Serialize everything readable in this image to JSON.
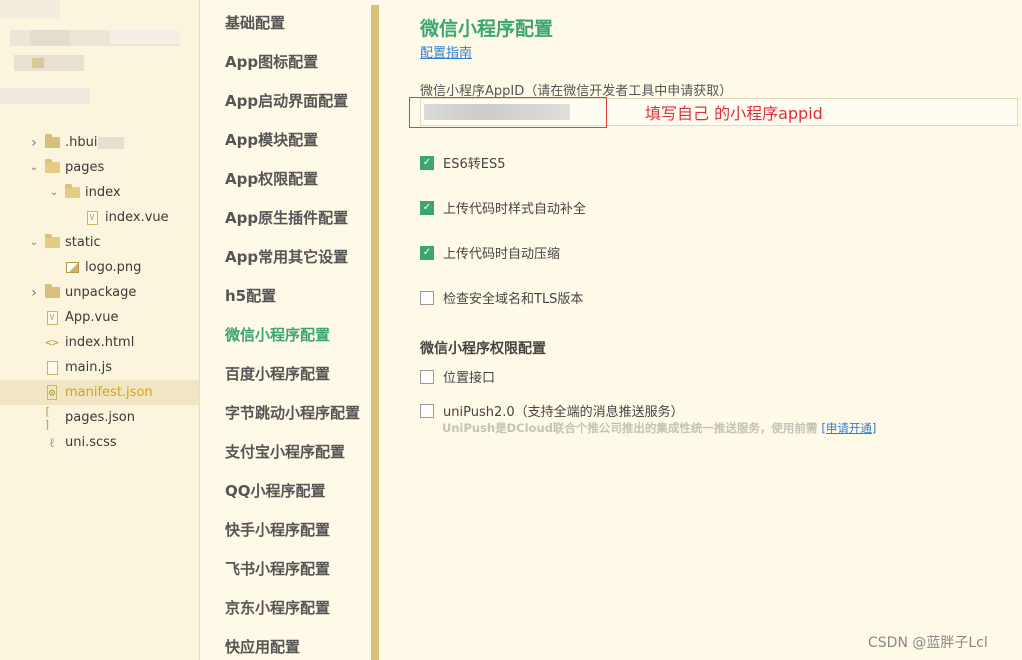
{
  "file_tree": {
    "items": [
      {
        "label": ".hbui",
        "kind": "folder",
        "expanded": false,
        "indent": 0
      },
      {
        "label": "pages",
        "kind": "folder",
        "expanded": true,
        "indent": 0
      },
      {
        "label": "index",
        "kind": "folder",
        "expanded": true,
        "indent": 1
      },
      {
        "label": "index.vue",
        "kind": "vue",
        "indent": 2
      },
      {
        "label": "static",
        "kind": "folder",
        "expanded": true,
        "indent": 0
      },
      {
        "label": "logo.png",
        "kind": "image",
        "indent": 1
      },
      {
        "label": "unpackage",
        "kind": "folder",
        "expanded": false,
        "indent": 0
      },
      {
        "label": "App.vue",
        "kind": "vue",
        "indent": 0
      },
      {
        "label": "index.html",
        "kind": "html",
        "indent": 0
      },
      {
        "label": "main.js",
        "kind": "js",
        "indent": 0
      },
      {
        "label": "manifest.json",
        "kind": "json-settings",
        "indent": 0,
        "selected": true
      },
      {
        "label": "pages.json",
        "kind": "json",
        "indent": 0
      },
      {
        "label": "uni.scss",
        "kind": "scss",
        "indent": 0
      }
    ]
  },
  "nav": {
    "items": [
      {
        "label": "基础配置"
      },
      {
        "label": "App图标配置"
      },
      {
        "label": "App启动界面配置"
      },
      {
        "label": "App模块配置"
      },
      {
        "label": "App权限配置"
      },
      {
        "label": "App原生插件配置"
      },
      {
        "label": "App常用其它设置"
      },
      {
        "label": "h5配置"
      },
      {
        "label": "微信小程序配置",
        "active": true
      },
      {
        "label": "百度小程序配置"
      },
      {
        "label": "字节跳动小程序配置"
      },
      {
        "label": "支付宝小程序配置"
      },
      {
        "label": "QQ小程序配置"
      },
      {
        "label": "快手小程序配置"
      },
      {
        "label": "飞书小程序配置"
      },
      {
        "label": "京东小程序配置"
      },
      {
        "label": "快应用配置"
      }
    ]
  },
  "main": {
    "title": "微信小程序配置",
    "guide_link": "配置指南",
    "appid_label": "微信小程序AppID（请在微信开发者工具中申请获取）",
    "annotation": "填写自己 的小程序appid",
    "options": [
      {
        "label": "ES6转ES5",
        "checked": true
      },
      {
        "label": "上传代码时样式自动补全",
        "checked": true
      },
      {
        "label": "上传代码时自动压缩",
        "checked": true
      },
      {
        "label": "检查安全域名和TLS版本",
        "checked": false
      }
    ],
    "permissions_title": "微信小程序权限配置",
    "permissions": [
      {
        "label": "位置接口",
        "checked": false
      },
      {
        "label": "uniPush2.0（支持全端的消息推送服务）",
        "checked": false
      }
    ],
    "unipush_desc": "UniPush是DCloud联合个推公司推出的集成性统一推送服务，使用前需",
    "unipush_link": "[申请开通]"
  },
  "watermark": "CSDN @蓝胖子Lcl",
  "colors": {
    "accent_green": "#3aa672",
    "link_blue": "#2f7fd0",
    "annotation_red": "#e0303a",
    "selected_file": "#d6a21a"
  }
}
